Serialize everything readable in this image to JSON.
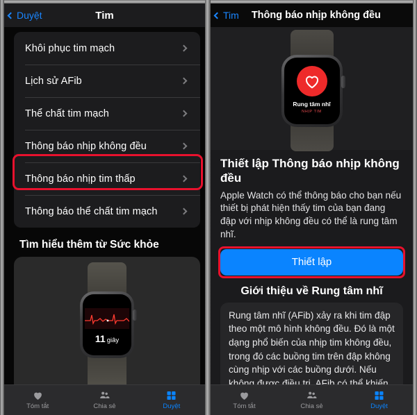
{
  "left_panel": {
    "nav": {
      "back_label": "Duyệt",
      "title": "Tim"
    },
    "list_items": [
      {
        "label": "Khôi phục tim mạch"
      },
      {
        "label": "Lịch sử AFib"
      },
      {
        "label": "Thể chất tim mạch"
      },
      {
        "label": "Thông báo nhịp không đều"
      },
      {
        "label": "Thông báo nhịp tim thấp"
      },
      {
        "label": "Thông báo thể chất tim mạch"
      }
    ],
    "highlighted_item_index": 3,
    "section_title": "Tìm hiểu thêm từ Sức khỏe",
    "media_card": {
      "ecg_value": "11",
      "ecg_unit": "giây"
    },
    "tabs": [
      {
        "label": "Tóm tắt",
        "icon": "heart-icon",
        "active": false
      },
      {
        "label": "Chia sẻ",
        "icon": "people-icon",
        "active": false
      },
      {
        "label": "Duyệt",
        "icon": "grid-icon",
        "active": true
      }
    ]
  },
  "right_panel": {
    "nav": {
      "back_label": "Tim",
      "title": "Thông báo nhịp không đều"
    },
    "watch": {
      "label": "Rung tâm nhĩ",
      "sublabel": "NHỊP TIM"
    },
    "title": "Thiết lập Thông báo nhịp không đều",
    "description": "Apple Watch có thể thông báo cho bạn nếu thiết bị phát hiện thấy tim của bạn đang đập với nhịp không đều có thể là rung tâm nhĩ.",
    "setup_button": "Thiết lập",
    "section_title": "Giới thiệu về Rung tâm nhĩ",
    "section_text": "Rung tâm nhĩ (AFib) xảy ra khi tim đập theo một mô hình không đều. Đó là một dạng phổ biến của nhịp tim không đều, trong đó các buồng tim trên đập không cùng nhịp với các buồng dưới. Nếu không được điều trị, AFib có thể khiến",
    "tabs": [
      {
        "label": "Tóm tắt",
        "icon": "heart-icon",
        "active": false
      },
      {
        "label": "Chia sẻ",
        "icon": "people-icon",
        "active": false
      },
      {
        "label": "Duyệt",
        "icon": "grid-icon",
        "active": true
      }
    ]
  },
  "colors": {
    "annotation_red": "#e8112d",
    "accent_blue": "#0a84ff",
    "back_link_blue": "#1a86ff",
    "heart_red": "#ee2a2a",
    "card_bg": "#1c1c1e"
  }
}
